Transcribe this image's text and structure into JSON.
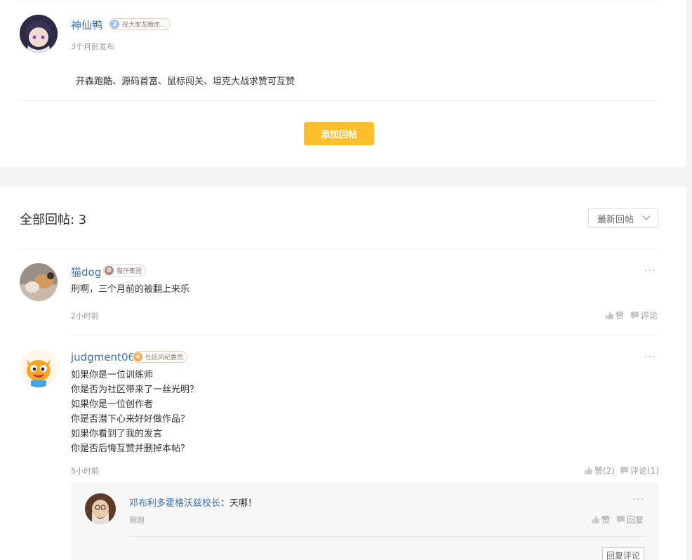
{
  "post": {
    "author": "神仙鸭",
    "badge_level": "2",
    "badge_text": "祝大家龙腾虎...",
    "time": "3个月前发布",
    "content": "开森跑酷、源码首富、鼠标闯关、坦克大战求赞可互赞"
  },
  "add_reply_button": "添加回帖",
  "replies_section": {
    "title": "全部回帖: 3",
    "sort_label": "最新回帖",
    "sort_icon": "chevron-down-icon"
  },
  "replies": [
    {
      "author": "猫dog",
      "badge_level": "0",
      "badge_text": "猫仔集团",
      "badge_color": "#a9887a",
      "content": [
        "刑啊，三个月前的被翻上来乐"
      ],
      "time": "2小时前",
      "like_label": "赞",
      "comment_label": "评论"
    },
    {
      "author": "judgment06",
      "badge_level": "4",
      "badge_text": "社区风纪委员",
      "badge_color": "#f4a95a",
      "content": [
        "如果你是一位训练师",
        "你是否为社区带来了一丝光明？",
        "如果你是一位创作者",
        "你是否潜下心来好好做作品？",
        "如果你看到了我的发言",
        "你是否后悔互赞并删掉本帖？"
      ],
      "time": "5小时前",
      "like_label": "赞(2)",
      "comment_label": "评论(1)"
    }
  ],
  "nested_reply": {
    "author": "邓布利多霍格沃兹校长",
    "text": "：天哪！",
    "time": "刚刚",
    "like_label": "赞",
    "reply_label": "回复",
    "reply_comment_button": "回复评论"
  },
  "more_label": "···",
  "colors": {
    "accent_button": "#fbbe2d",
    "username": "#3f6fa8",
    "post_badge": "#9ec1ea"
  }
}
